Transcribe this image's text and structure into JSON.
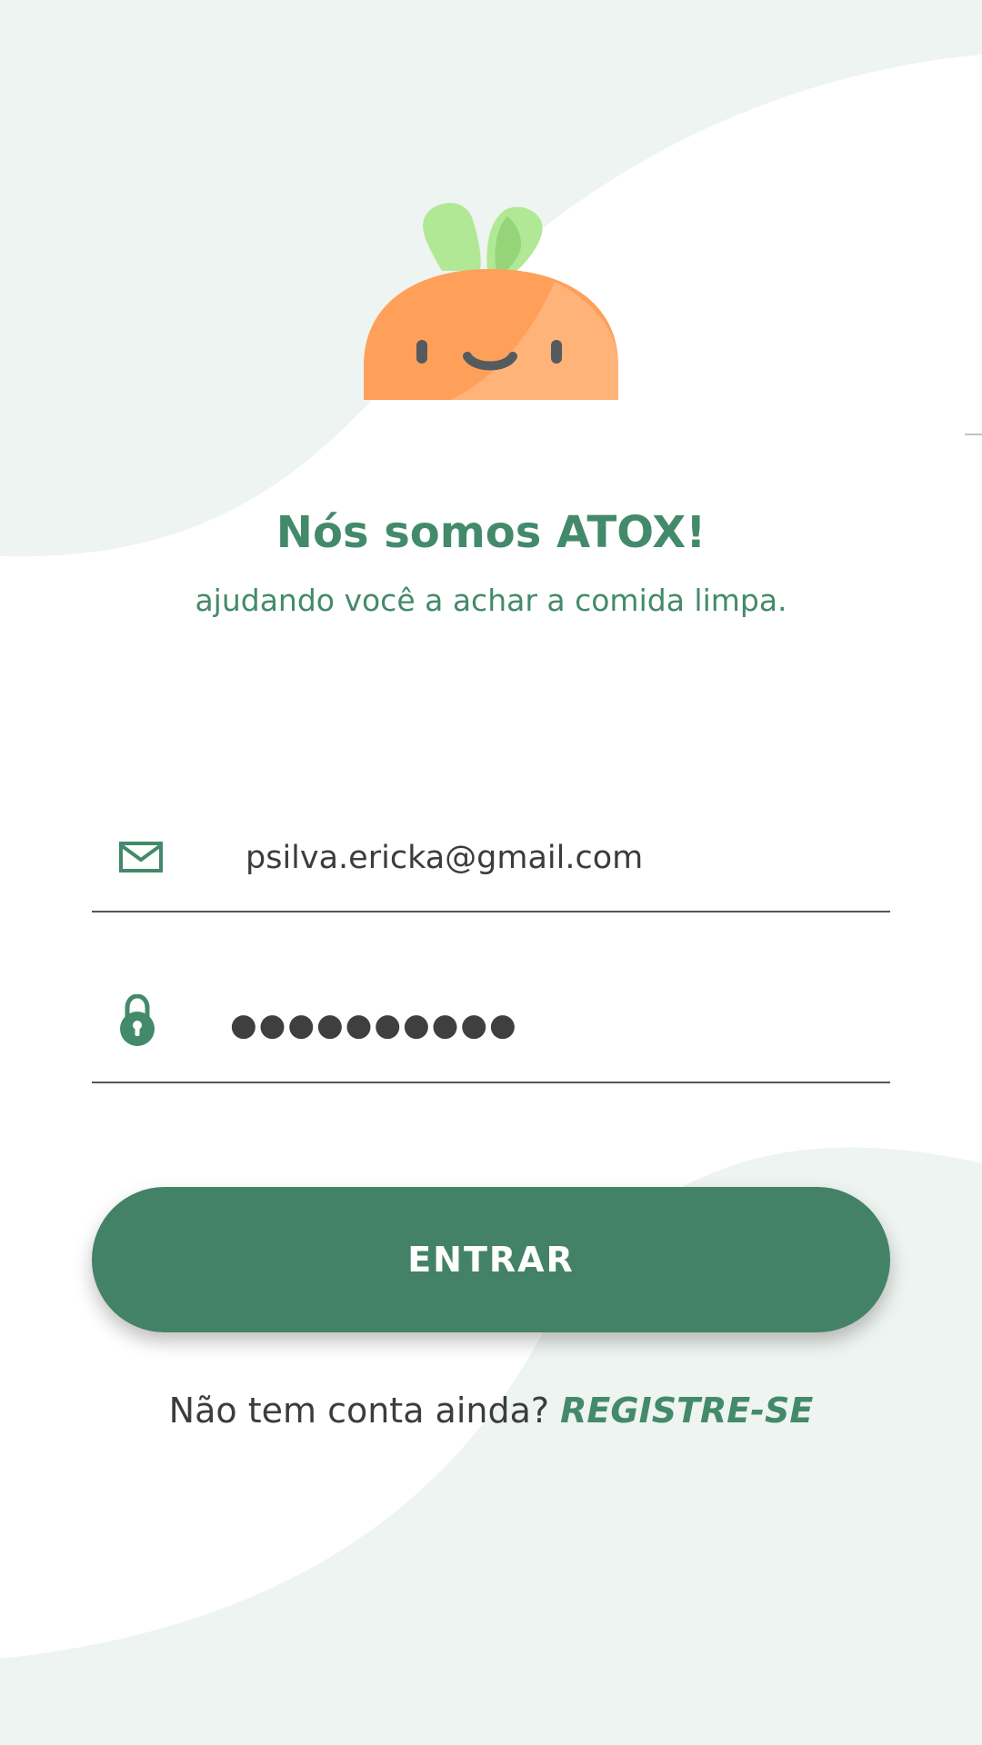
{
  "header": {
    "title": "Nós somos ATOX!",
    "subtitle": "ajudando você a achar a comida limpa."
  },
  "login": {
    "email_icon": "envelope-icon",
    "email_value": "psilva.ericka@gmail.com",
    "password_icon": "lock-icon",
    "password_value": "●●●●●●●●●●",
    "submit_label": "ENTRAR"
  },
  "footer": {
    "prompt": "Não tem conta ainda?",
    "register_label": "REGISTRE-SE"
  },
  "theme": {
    "primary": "#438266",
    "accent_text": "#438A6B",
    "background_tint": "#EEF4F1",
    "carrot_orange": "#FFA05A",
    "leaf_green": "#B1E895"
  }
}
